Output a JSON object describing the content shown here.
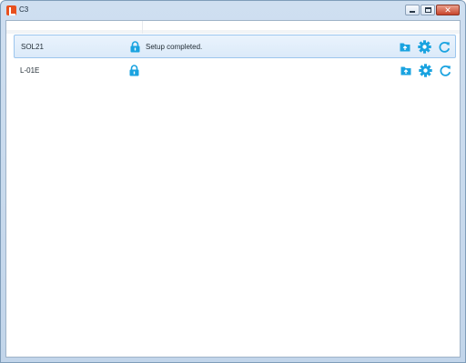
{
  "window": {
    "title": "C3"
  },
  "devices": [
    {
      "name": "SOL21",
      "status": "Setup completed.",
      "selected": true
    },
    {
      "name": "L-01E",
      "status": "",
      "selected": false
    }
  ],
  "icons": {
    "lock": "lock-icon",
    "folder": "folder-upload-icon",
    "settings": "gear-icon",
    "refresh": "refresh-icon"
  },
  "colors": {
    "accent": "#1aa3e0",
    "selected_row": "#dbeaf9",
    "selected_border": "#9cc6ee"
  }
}
